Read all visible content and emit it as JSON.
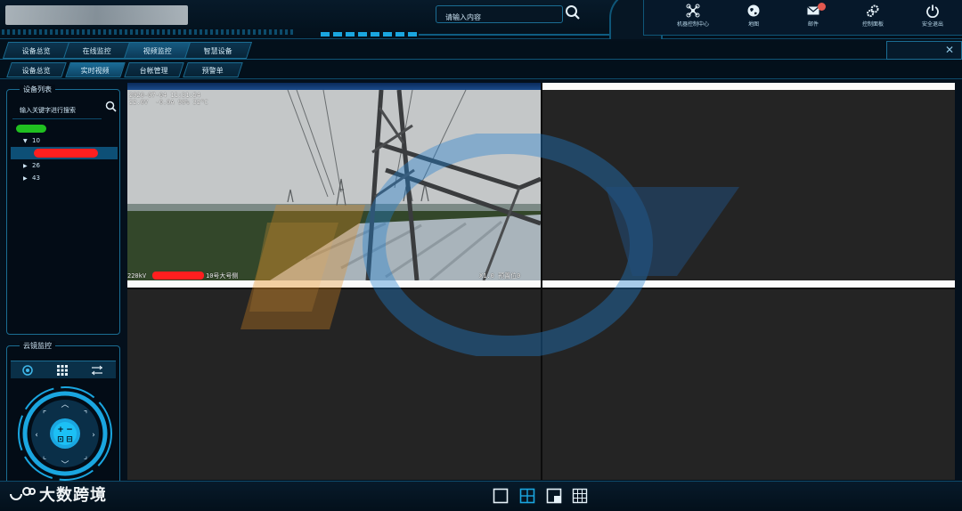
{
  "header": {
    "search_placeholder": "请输入内容",
    "buttons": [
      {
        "label": "机器控制中心",
        "icon": "drone-icon"
      },
      {
        "label": "地图",
        "icon": "globe-icon"
      },
      {
        "label": "邮件",
        "icon": "mail-icon"
      },
      {
        "label": "控制面板",
        "icon": "gears-icon"
      },
      {
        "label": "安全退出",
        "icon": "power-icon"
      }
    ]
  },
  "menu_primary": [
    "设备总览",
    "在线监控",
    "视频监控",
    "智慧设备"
  ],
  "menu_secondary": [
    "设备总览",
    "实时视频",
    "台帐管理",
    "预警单"
  ],
  "device_panel": {
    "title": "设备列表",
    "search_placeholder": "输入关键字进行搜索",
    "tree": [
      {
        "label": "10",
        "expanded": true
      },
      {
        "label": "26",
        "expanded": false
      },
      {
        "label": "43",
        "expanded": false
      }
    ]
  },
  "ptz_panel": {
    "title": "云镜监控",
    "zoom_plus": "+",
    "zoom_minus": "−",
    "focus_labels": [
      "⊡",
      "⊟"
    ]
  },
  "video": {
    "osd_time": "2020-07-04 11:31:54",
    "osd_env": "22.0V  -0.0A 98% 32°C",
    "osd_line_prefix": "220kV",
    "osd_line_suffix": "10号大号侧",
    "osd_zoom": "X1.0 预置位0"
  },
  "footer": {
    "brand": "大数跨境"
  },
  "colors": {
    "accent": "#1aa6e0",
    "panel_border": "#1b6d93",
    "active_tab": "#0d4f76"
  }
}
